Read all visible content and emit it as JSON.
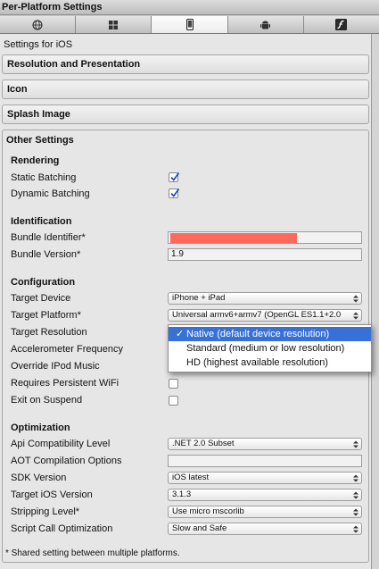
{
  "window": {
    "title": "Per-Platform Settings"
  },
  "platform_tabs": [
    {
      "icon": "globe-icon"
    },
    {
      "icon": "standalone-icon"
    },
    {
      "icon": "iphone-icon"
    },
    {
      "icon": "android-icon"
    },
    {
      "icon": "flash-icon"
    }
  ],
  "header": {
    "text": "Settings for iOS"
  },
  "sections": {
    "resolution": "Resolution and Presentation",
    "icon": "Icon",
    "splash": "Splash Image",
    "other": "Other Settings"
  },
  "rendering": {
    "title": "Rendering",
    "static_batching": "Static Batching",
    "dynamic_batching": "Dynamic Batching"
  },
  "identification": {
    "title": "Identification",
    "bundle_identifier_label": "Bundle Identifier*",
    "bundle_version_label": "Bundle Version*",
    "bundle_version_value": "1.9"
  },
  "configuration": {
    "title": "Configuration",
    "target_device_label": "Target Device",
    "target_device_value": "iPhone + iPad",
    "target_platform_label": "Target Platform*",
    "target_platform_value": "Universal armv6+armv7 (OpenGL ES1.1+2.0",
    "target_resolution_label": "Target Resolution",
    "accelerometer_label": "Accelerometer Frequency",
    "override_ipod_label": "Override IPod Music",
    "persistent_wifi_label": "Requires Persistent WiFi",
    "exit_on_suspend_label": "Exit on Suspend"
  },
  "resolution_menu": {
    "options": [
      "Native (default device resolution)",
      "Standard (medium or low resolution)",
      "HD (highest available resolution)"
    ],
    "selected": "Native (default device resolution)"
  },
  "optimization": {
    "title": "Optimization",
    "api_label": "Api Compatibility Level",
    "api_value": ".NET 2.0 Subset",
    "aot_label": "AOT Compilation Options",
    "sdk_label": "SDK Version",
    "sdk_value": "iOS latest",
    "target_ios_label": "Target iOS Version",
    "target_ios_value": "3.1.3",
    "stripping_label": "Stripping Level*",
    "stripping_value": "Use micro mscorlib",
    "script_call_label": "Script Call Optimization",
    "script_call_value": "Slow and Safe"
  },
  "footer": {
    "note": "* Shared setting between multiple platforms."
  },
  "colors": {
    "accent": "#3771d7",
    "redacted": "#fb6a5d",
    "panel": "#e6e6e6"
  }
}
